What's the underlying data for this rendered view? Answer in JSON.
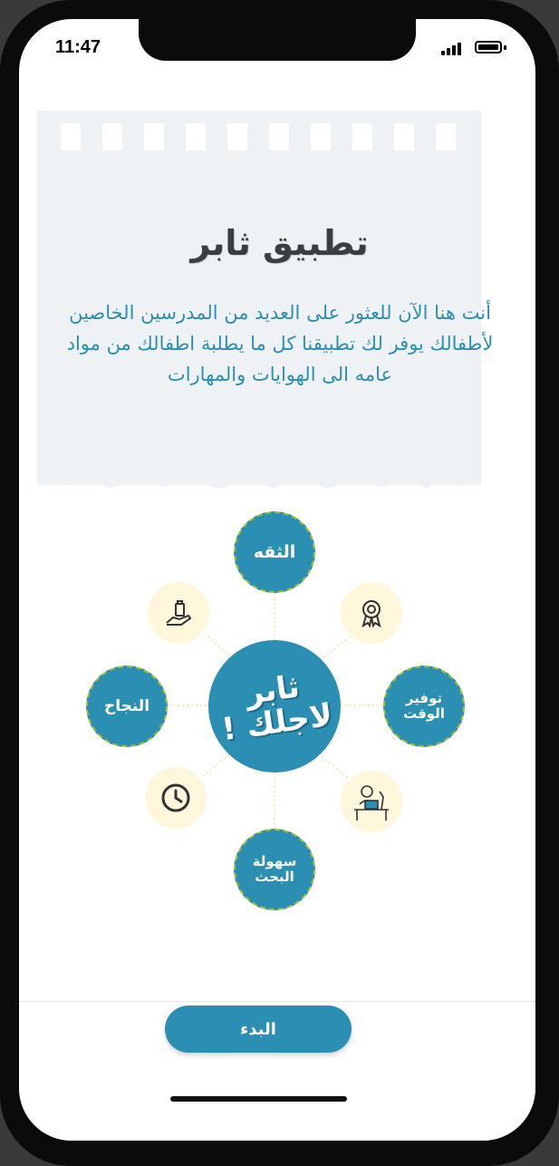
{
  "status": {
    "time": "11:47"
  },
  "intro": {
    "title": "تطبيق ثابر",
    "description": "أنت هنا الآن للعثور على العديد من المدرسين الخاصين لأطفالك يوفر لك تطبيقنا كل ما يطلبة اطفالك من مواد عامه الى الهوايات والمهارات"
  },
  "diagram": {
    "center": "ثابر\nلاجلك !",
    "nodes": {
      "top": "الثقه",
      "right": "توفير\nالوقت",
      "left": "النجاح",
      "bottom": "سهولة\nالبحث"
    },
    "icons": [
      "hand-bag-icon",
      "award-ribbon-icon",
      "clock-icon",
      "desk-worker-icon"
    ],
    "colors": {
      "primary": "#2a8fb2",
      "accent_border": "#9dbd3a",
      "icon_bg": "#fff7dc"
    }
  },
  "footer": {
    "start_label": "البدء"
  }
}
